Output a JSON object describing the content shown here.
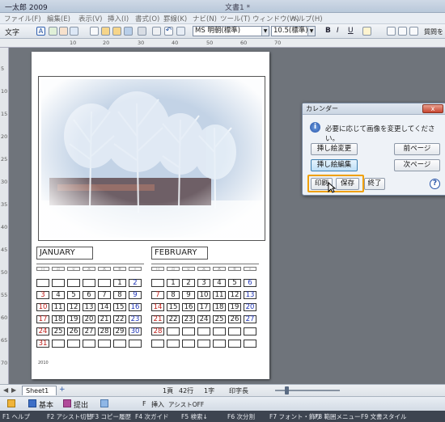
{
  "window": {
    "app_title": "一太郎 2009",
    "doc_title": "文書1 *"
  },
  "menu": [
    "ファイル(F)",
    "編集(E)",
    "表示(V)",
    "挿入(I)",
    "書式(O)",
    "罫線(K)",
    "ナビ(N)",
    "ツール(T)",
    "ウィンドウ(W)",
    "ヘルプ(H)"
  ],
  "toolbar": {
    "mode_label": "文字",
    "font_name": "MS 明朝(標準)",
    "font_size": "10.5(標準)",
    "bold": "B",
    "italic": "I",
    "underline": "U",
    "style_label": "質問を"
  },
  "ruler": {
    "h_marks": [
      "10",
      "20",
      "30",
      "40",
      "50",
      "60",
      "70"
    ],
    "v_marks": [
      "5",
      "10",
      "15",
      "20",
      "25",
      "30",
      "35",
      "40",
      "45",
      "50",
      "55",
      "60",
      "65",
      "70"
    ]
  },
  "calendar": {
    "weekday_marks": [
      "日",
      "月",
      "火",
      "水",
      "木",
      "金",
      "土"
    ],
    "january": {
      "label": "JANUARY",
      "rows": [
        [
          "",
          "",
          "",
          "",
          "",
          "1",
          "2"
        ],
        [
          "3",
          "4",
          "5",
          "6",
          "7",
          "8",
          "9"
        ],
        [
          "10",
          "11",
          "12",
          "13",
          "14",
          "15",
          "16"
        ],
        [
          "17",
          "18",
          "19",
          "20",
          "21",
          "22",
          "23"
        ],
        [
          "24",
          "25",
          "26",
          "27",
          "28",
          "29",
          "30"
        ],
        [
          "31",
          "",
          "",
          "",
          "",
          "",
          ""
        ]
      ]
    },
    "february": {
      "label": "FEBRUARY",
      "rows": [
        [
          "",
          "1",
          "2",
          "3",
          "4",
          "5",
          "6"
        ],
        [
          "7",
          "8",
          "9",
          "10",
          "11",
          "12",
          "13"
        ],
        [
          "14",
          "15",
          "16",
          "17",
          "18",
          "19",
          "20"
        ],
        [
          "21",
          "22",
          "23",
          "24",
          "25",
          "26",
          "27"
        ],
        [
          "28",
          "",
          "",
          "",
          "",
          "",
          ""
        ],
        [
          "",
          "",
          "",
          "",
          "",
          "",
          ""
        ]
      ]
    },
    "year_small": "2010"
  },
  "dialog": {
    "title": "カレンダー",
    "message": "必要に応じて画像を変更してください。",
    "btn_change_image": "挿し絵変更",
    "btn_prev_page": "前ページ",
    "btn_edit_image": "挿し絵編集",
    "btn_next_page": "次ページ",
    "btn_print": "印刷",
    "btn_save": "保存",
    "btn_close": "終了",
    "help_glyph": "?",
    "close_glyph": "x"
  },
  "status": {
    "sheet_tab": "Sheet1",
    "page": "1頁",
    "line": "42行",
    "column": "1字",
    "zoom_label": "印字長"
  },
  "bottom": {
    "basic": "基本",
    "submit": "提出",
    "insert_key": "F",
    "insert_mode": "挿入",
    "assist": "アシストOFF"
  },
  "fnkeys": [
    "F1 ヘルプ",
    "F2 アシスト切替",
    "F3 コピー履歴",
    "F4 次ガイド",
    "F5 検索↓",
    "F6 次分割",
    "F7 フォント・飾り",
    "F8 範囲メニュー",
    "F9 文書スタイル"
  ]
}
